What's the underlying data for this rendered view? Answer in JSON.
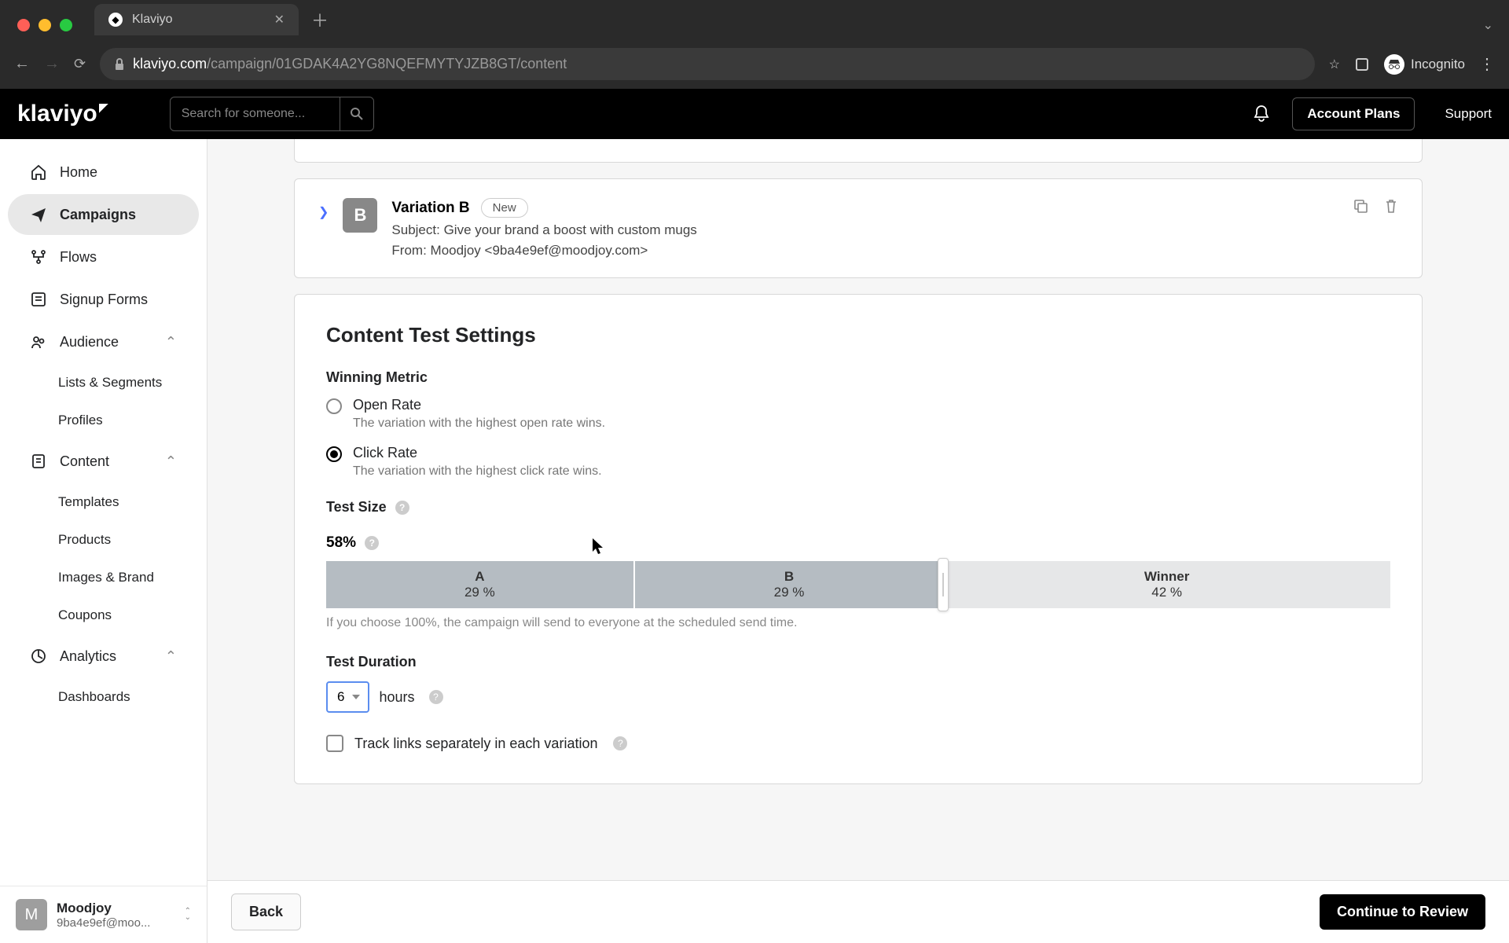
{
  "browser": {
    "tab_title": "Klaviyo",
    "incognito_label": "Incognito",
    "url_domain": "klaviyo.com",
    "url_path": "/campaign/01GDAK4A2YG8NQEFMYTYJZB8GT/content"
  },
  "header": {
    "logo_text": "klaviyo",
    "search_placeholder": "Search for someone...",
    "account_plans": "Account Plans",
    "support": "Support"
  },
  "sidebar": {
    "items": [
      {
        "label": "Home"
      },
      {
        "label": "Campaigns"
      },
      {
        "label": "Flows"
      },
      {
        "label": "Signup Forms"
      },
      {
        "label": "Audience",
        "expandable": true,
        "children": [
          "Lists & Segments",
          "Profiles"
        ]
      },
      {
        "label": "Content",
        "expandable": true,
        "children": [
          "Templates",
          "Products",
          "Images & Brand",
          "Coupons"
        ]
      },
      {
        "label": "Analytics",
        "expandable": true,
        "children": [
          "Dashboards"
        ]
      }
    ],
    "org": {
      "avatar": "M",
      "name": "Moodjoy",
      "email": "9ba4e9ef@moo..."
    }
  },
  "variation": {
    "letter": "B",
    "title": "Variation B",
    "new_badge": "New",
    "subject_label": "Subject:",
    "subject": "Give your brand a boost with custom mugs",
    "from_label": "From:",
    "from": "Moodjoy <9ba4e9ef@moodjoy.com>"
  },
  "settings": {
    "title": "Content Test Settings",
    "winning_metric_label": "Winning Metric",
    "open_rate": {
      "label": "Open Rate",
      "desc": "The variation with the highest open rate wins."
    },
    "click_rate": {
      "label": "Click Rate",
      "desc": "The variation with the highest click rate wins."
    },
    "test_size_label": "Test Size",
    "test_size_value": "58%",
    "seg_a_label": "A",
    "seg_a_pct": "29 %",
    "seg_b_label": "B",
    "seg_b_pct": "29 %",
    "seg_w_label": "Winner",
    "seg_w_pct": "42 %",
    "slider_note": "If you choose 100%, the campaign will send to everyone at the scheduled send time.",
    "duration_label": "Test Duration",
    "duration_value": "6",
    "duration_unit": "hours",
    "track_label": "Track links separately in each variation"
  },
  "footer": {
    "back": "Back",
    "continue": "Continue to Review"
  }
}
